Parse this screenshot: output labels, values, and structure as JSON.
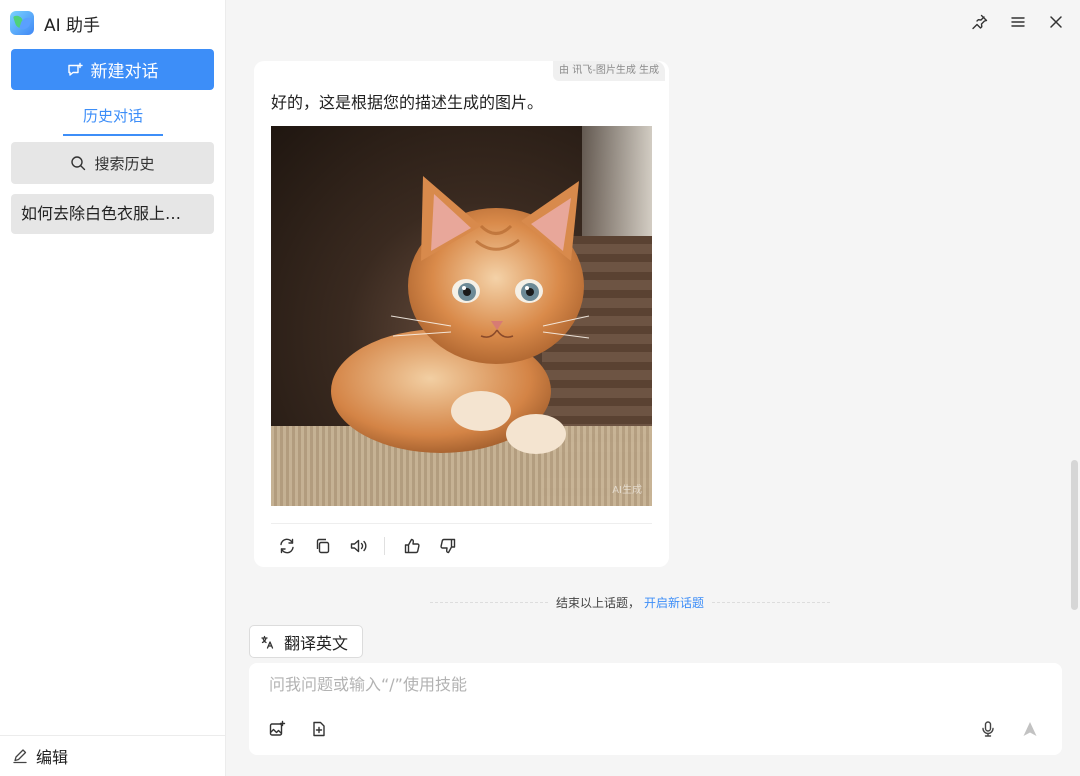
{
  "sidebar": {
    "app_title": "AI 助手",
    "new_chat_label": "新建对话",
    "history_tab_label": "历史对话",
    "search_history_label": "搜索历史",
    "conversations": [
      {
        "title": "如何去除白色衣服上…"
      }
    ],
    "footer_edit_label": "编辑"
  },
  "top_controls": {
    "icons": [
      "pin-icon",
      "menu-icon",
      "close-icon"
    ]
  },
  "message": {
    "source_tag": "由 讯飞-图片生成 生成",
    "text": "好的，这是根据您的描述生成的图片。",
    "image_watermark": "AI生成",
    "action_icons": [
      "regenerate-icon",
      "copy-icon",
      "speaker-icon",
      "thumbs-up-icon",
      "thumbs-down-icon"
    ]
  },
  "topic_end": {
    "text": "结束以上话题，",
    "link": "开启新话题"
  },
  "skill_chip": {
    "label": "翻译英文"
  },
  "input": {
    "placeholder": "问我问题或输入“/”使用技能",
    "value": ""
  },
  "colors": {
    "accent": "#3d8ef8",
    "background": "#f5f5f5",
    "card": "#ffffff"
  }
}
